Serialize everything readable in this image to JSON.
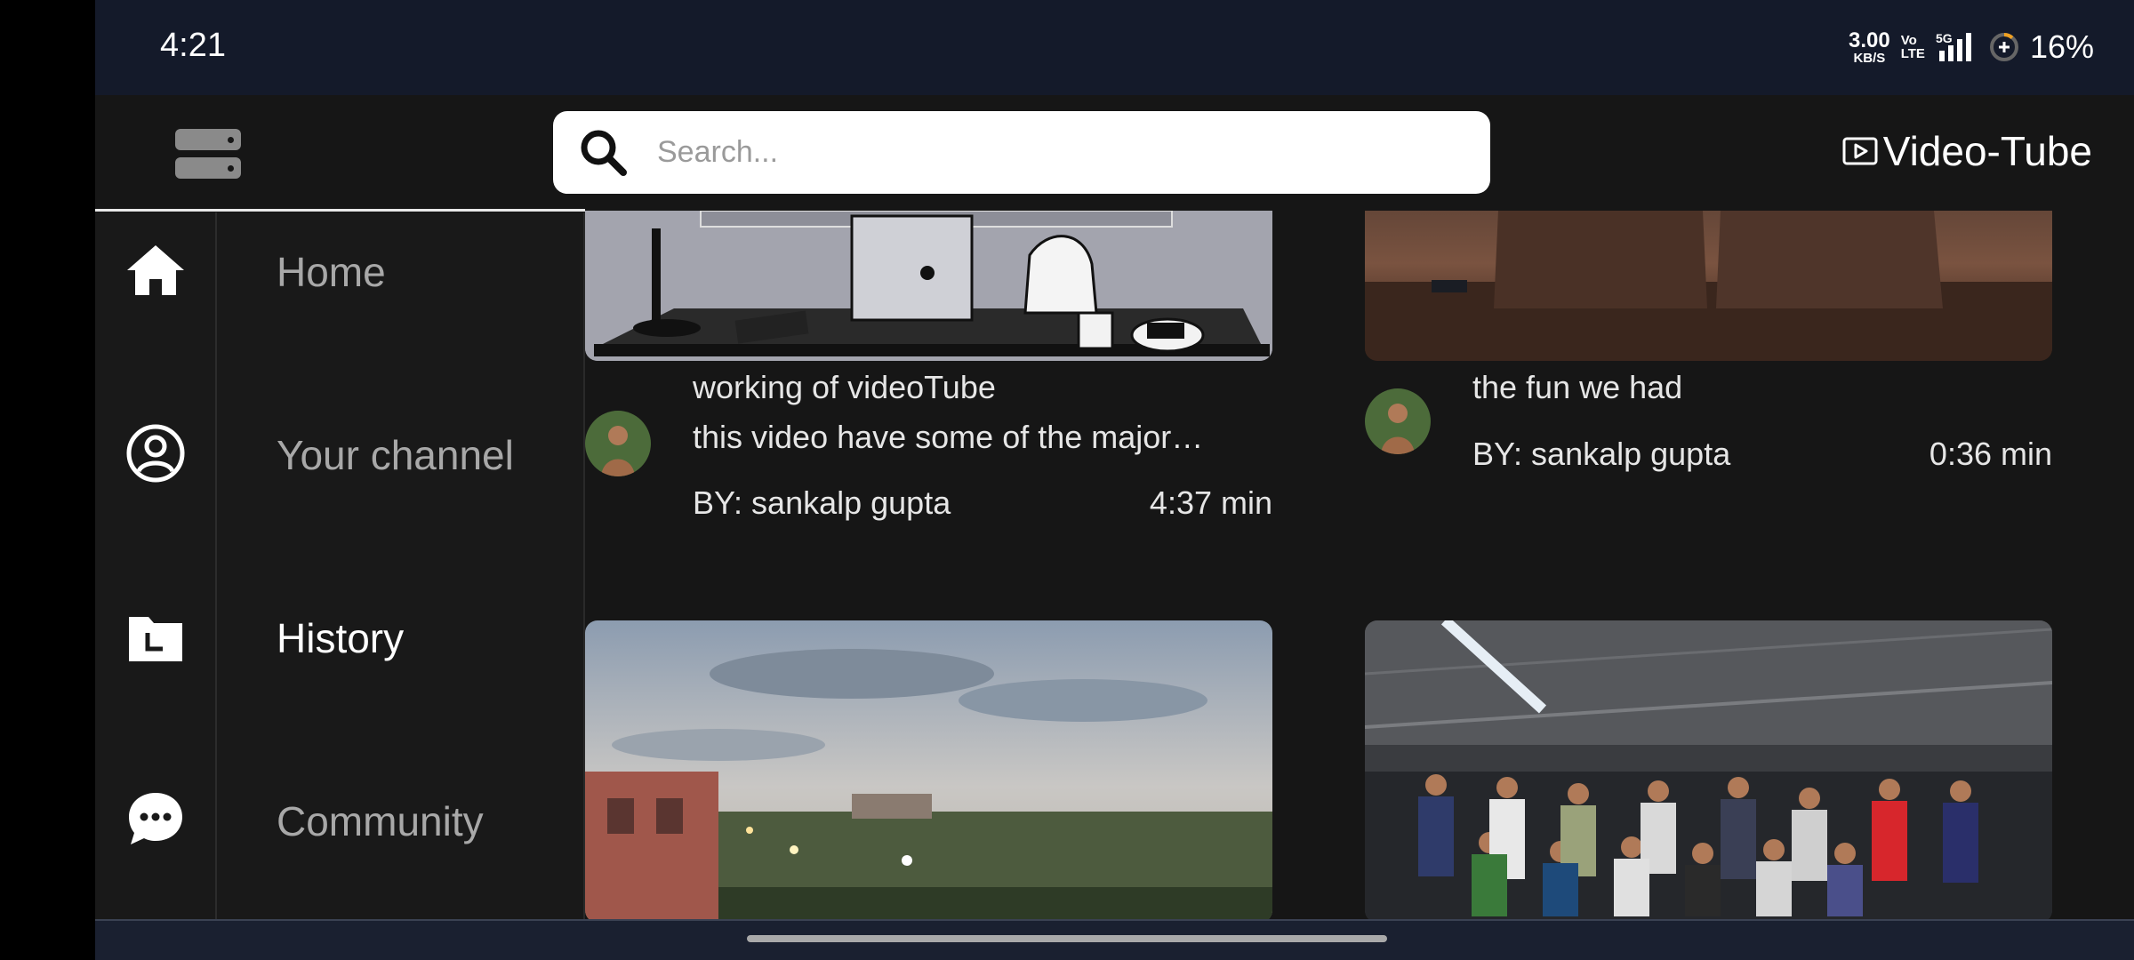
{
  "status_bar": {
    "time": "4:21",
    "net_speed_value": "3.00",
    "net_speed_unit": "KB/S",
    "volte_top": "Vo",
    "volte_bottom": "LTE",
    "network_type": "5G",
    "battery_percent": "16%"
  },
  "app_bar": {
    "search_placeholder": "Search...",
    "brand_name": "Video-Tube"
  },
  "sidebar": {
    "items": [
      {
        "label": "Home",
        "icon": "home-icon"
      },
      {
        "label": "Your channel",
        "icon": "account-circle-icon"
      },
      {
        "label": "History",
        "icon": "history-folder-icon",
        "active": true
      },
      {
        "label": "Community",
        "icon": "chat-bubble-icon"
      }
    ]
  },
  "videos": [
    {
      "title": "working of videoTube",
      "description": "this video have some of the major…",
      "byline": "BY: sankalp gupta",
      "duration": "4:37 min"
    },
    {
      "title": "the fun we had",
      "byline": "BY: sankalp gupta",
      "duration": "0:36 min"
    },
    {
      "thumbnail": "evening-landscape"
    },
    {
      "thumbnail": "group-photo"
    }
  ],
  "colors": {
    "status_bar_bg": "#141a2a",
    "app_bg": "#161616",
    "sidebar_bg": "#191919",
    "text_primary": "#ffffff",
    "text_muted": "#a8a8a8"
  }
}
